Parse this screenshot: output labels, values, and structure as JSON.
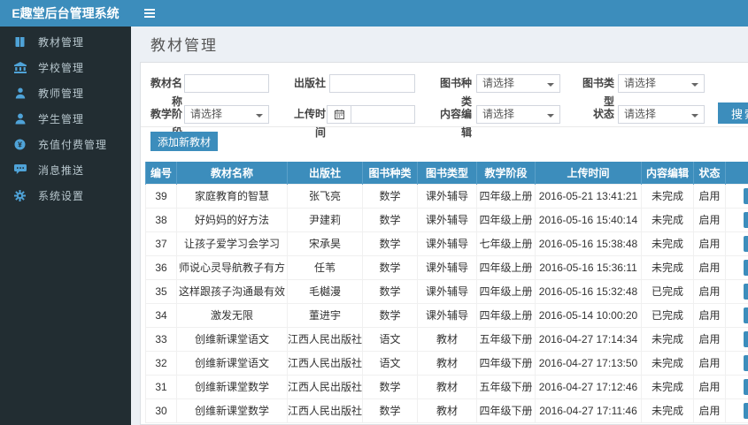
{
  "app": {
    "title": "E趣堂后台管理系统"
  },
  "page": {
    "title": "教材管理"
  },
  "sidebar": {
    "items": [
      {
        "icon": "book-icon",
        "label": "教材管理"
      },
      {
        "icon": "bank-icon",
        "label": "学校管理"
      },
      {
        "icon": "teacher-icon",
        "label": "教师管理"
      },
      {
        "icon": "student-icon",
        "label": "学生管理"
      },
      {
        "icon": "recharge-icon",
        "label": "充值付费管理"
      },
      {
        "icon": "message-icon",
        "label": "消息推送"
      },
      {
        "icon": "gear-icon",
        "label": "系统设置"
      }
    ]
  },
  "filters": {
    "fields": [
      {
        "label": "教材名称",
        "type": "input",
        "value": ""
      },
      {
        "label": "出版社",
        "type": "input",
        "value": ""
      },
      {
        "label": "图书种类",
        "type": "select",
        "value": "请选择"
      },
      {
        "label": "图书类型",
        "type": "select",
        "value": "请选择"
      },
      {
        "label": "教学阶段",
        "type": "select",
        "value": "请选择"
      },
      {
        "label": "上传时间",
        "type": "date",
        "value": ""
      },
      {
        "label": "内容编辑",
        "type": "select",
        "value": "请选择"
      },
      {
        "label": "状态",
        "type": "select",
        "value": "请选择"
      }
    ],
    "search_label": "搜索"
  },
  "toolbar": {
    "add_label": "添加新教材"
  },
  "table": {
    "headers": [
      "编号",
      "教材名称",
      "出版社",
      "图书种类",
      "图书类型",
      "教学阶段",
      "上传时间",
      "内容编辑",
      "状态",
      ""
    ],
    "rows": [
      {
        "cells": [
          "39",
          "家庭教育的智慧",
          "张飞亮",
          "数学",
          "课外辅导",
          "四年级上册",
          "2016-05-21 13:41:21",
          "未完成",
          "启用"
        ]
      },
      {
        "cells": [
          "38",
          "好妈妈的好方法",
          "尹建莉",
          "数学",
          "课外辅导",
          "四年级上册",
          "2016-05-16 15:40:14",
          "未完成",
          "启用"
        ]
      },
      {
        "cells": [
          "37",
          "让孩子爱学习会学习",
          "宋承昊",
          "数学",
          "课外辅导",
          "七年级上册",
          "2016-05-16 15:38:48",
          "未完成",
          "启用"
        ]
      },
      {
        "cells": [
          "36",
          "师说心灵导航教子有方",
          "任苇",
          "数学",
          "课外辅导",
          "四年级上册",
          "2016-05-16 15:36:11",
          "未完成",
          "启用"
        ]
      },
      {
        "cells": [
          "35",
          "这样跟孩子沟通最有效",
          "毛樾漫",
          "数学",
          "课外辅导",
          "四年级上册",
          "2016-05-16 15:32:48",
          "已完成",
          "启用"
        ]
      },
      {
        "cells": [
          "34",
          "激发无限",
          "董进宇",
          "数学",
          "课外辅导",
          "四年级上册",
          "2016-05-14 10:00:20",
          "已完成",
          "启用"
        ]
      },
      {
        "cells": [
          "33",
          "创维新课堂语文",
          "江西人民出版社",
          "语文",
          "教材",
          "五年级下册",
          "2016-04-27 17:14:34",
          "未完成",
          "启用"
        ]
      },
      {
        "cells": [
          "32",
          "创维新课堂语文",
          "江西人民出版社",
          "语文",
          "教材",
          "四年级下册",
          "2016-04-27 17:13:50",
          "未完成",
          "启用"
        ]
      },
      {
        "cells": [
          "31",
          "创维新课堂数学",
          "江西人民出版社",
          "数学",
          "教材",
          "五年级下册",
          "2016-04-27 17:12:46",
          "未完成",
          "启用"
        ]
      },
      {
        "cells": [
          "30",
          "创维新课堂数学",
          "江西人民出版社",
          "数学",
          "教材",
          "四年级下册",
          "2016-04-27 17:11:46",
          "未完成",
          "启用"
        ]
      }
    ]
  },
  "colors": {
    "accent": "#3c8dbc",
    "sidebar_bg": "#222d32",
    "sidebar_text": "#b8c7ce",
    "icon_blue": "#4fa3d8",
    "content_bg": "#ecf0f5"
  }
}
